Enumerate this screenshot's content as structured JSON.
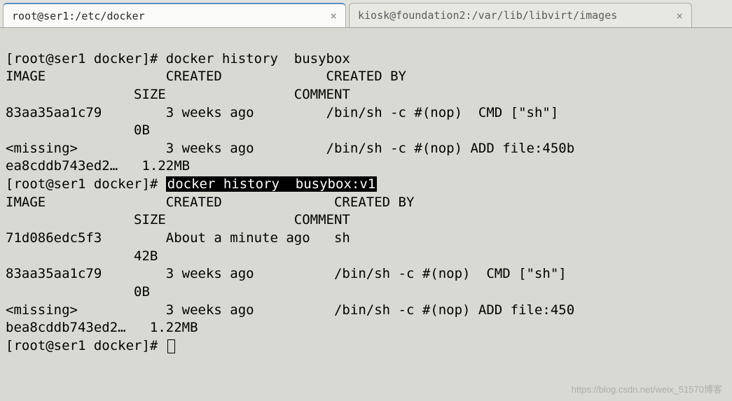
{
  "tabs": {
    "active": {
      "label": "root@ser1:/etc/docker",
      "close": "×"
    },
    "inactive": {
      "label": "kiosk@foundation2:/var/lib/libvirt/images",
      "close": "×"
    }
  },
  "terminal": {
    "line1": "[root@ser1 docker]# docker history  busybox",
    "line2": "IMAGE               CREATED             CREATED BY",
    "line3": "                SIZE                COMMENT",
    "line4": "83aa35aa1c79        3 weeks ago         /bin/sh -c #(nop)  CMD [\"sh\"]",
    "line5": "                0B",
    "line6": "<missing>           3 weeks ago         /bin/sh -c #(nop) ADD file:450b",
    "line7": "ea8cddb743ed2…   1.22MB",
    "prompt2": "[root@ser1 docker]# ",
    "cmd2_hl": "docker history  busybox:v1",
    "line9": "IMAGE               CREATED              CREATED BY",
    "line10": "                SIZE                COMMENT",
    "line11": "71d086edc5f3        About a minute ago   sh",
    "line12": "                42B",
    "line13": "83aa35aa1c79        3 weeks ago          /bin/sh -c #(nop)  CMD [\"sh\"]",
    "line14": "                0B",
    "line15": "<missing>           3 weeks ago          /bin/sh -c #(nop) ADD file:450",
    "line16": "bea8cddb743ed2…   1.22MB",
    "prompt3": "[root@ser1 docker]# "
  },
  "watermark": "https://blog.csdn.net/weix_51570博客"
}
